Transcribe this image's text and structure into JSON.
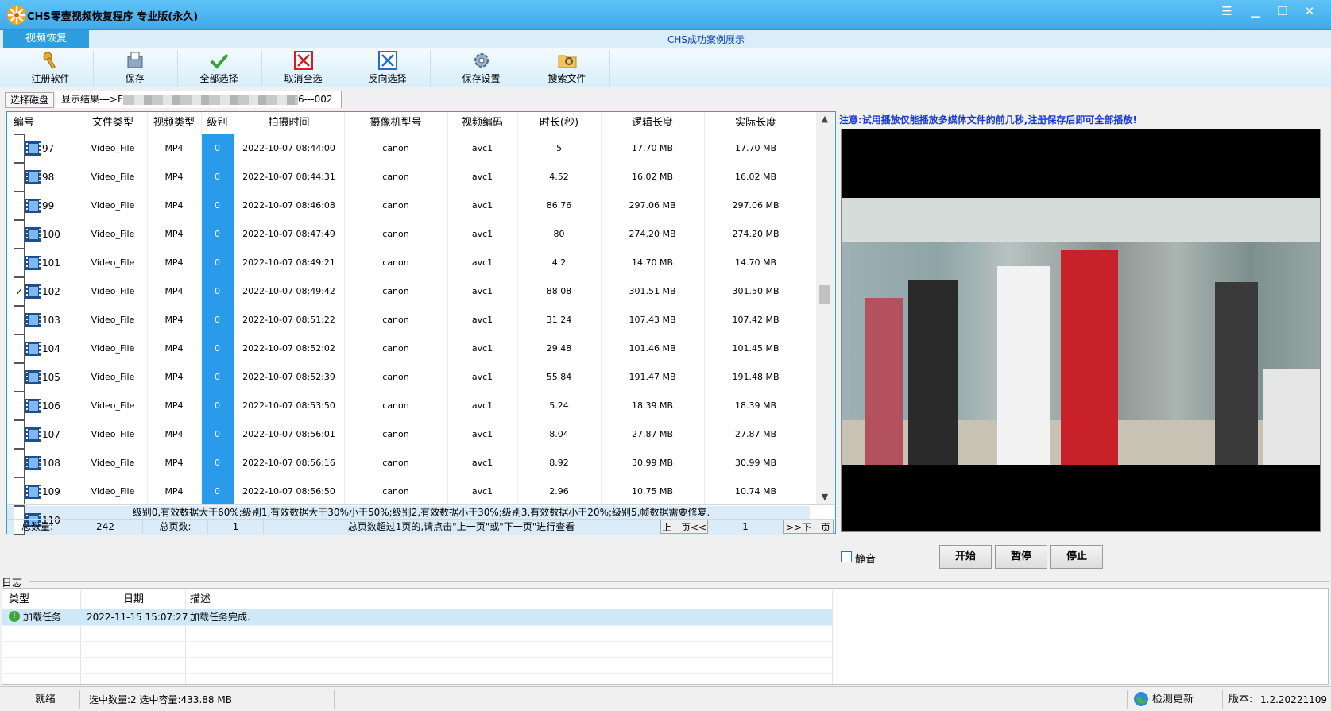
{
  "window": {
    "title": "CHS零壹视频恢复程序 专业版(永久)",
    "controls": [
      "menu-icon",
      "minimize-icon",
      "maximize-icon",
      "close-icon"
    ]
  },
  "tabs": {
    "active": "视频恢复",
    "case_link": "CHS成功案例展示"
  },
  "toolbar": {
    "register": "注册软件",
    "save": "保存",
    "select_all": "全部选择",
    "deselect_all": "取消全选",
    "invert": "反向选择",
    "save_settings": "保存设置",
    "search_file": "搜索文件"
  },
  "selector": {
    "disk_button": "选择磁盘",
    "result_prefix": "显示结果--->F",
    "result_suffix": "6---002"
  },
  "table": {
    "headers": [
      "编号",
      "文件类型",
      "视频类型",
      "级别",
      "拍摄时间",
      "摄像机型号",
      "视频编码",
      "时长(秒)",
      "逻辑长度",
      "实际长度"
    ],
    "rows": [
      {
        "id": "97",
        "checked": false,
        "ftype": "Video_File",
        "vtype": "MP4",
        "level": "0",
        "time": "2022-10-07 08:44:00",
        "camera": "canon",
        "codec": "avc1",
        "duration": "5",
        "logical": "17.70 MB",
        "actual": "17.70 MB"
      },
      {
        "id": "98",
        "checked": false,
        "ftype": "Video_File",
        "vtype": "MP4",
        "level": "0",
        "time": "2022-10-07 08:44:31",
        "camera": "canon",
        "codec": "avc1",
        "duration": "4.52",
        "logical": "16.02 MB",
        "actual": "16.02 MB"
      },
      {
        "id": "99",
        "checked": false,
        "ftype": "Video_File",
        "vtype": "MP4",
        "level": "0",
        "time": "2022-10-07 08:46:08",
        "camera": "canon",
        "codec": "avc1",
        "duration": "86.76",
        "logical": "297.06 MB",
        "actual": "297.06 MB"
      },
      {
        "id": "100",
        "checked": false,
        "ftype": "Video_File",
        "vtype": "MP4",
        "level": "0",
        "time": "2022-10-07 08:47:49",
        "camera": "canon",
        "codec": "avc1",
        "duration": "80",
        "logical": "274.20 MB",
        "actual": "274.20 MB"
      },
      {
        "id": "101",
        "checked": false,
        "ftype": "Video_File",
        "vtype": "MP4",
        "level": "0",
        "time": "2022-10-07 08:49:21",
        "camera": "canon",
        "codec": "avc1",
        "duration": "4.2",
        "logical": "14.70 MB",
        "actual": "14.70 MB"
      },
      {
        "id": "102",
        "checked": true,
        "ftype": "Video_File",
        "vtype": "MP4",
        "level": "0",
        "time": "2022-10-07 08:49:42",
        "camera": "canon",
        "codec": "avc1",
        "duration": "88.08",
        "logical": "301.51 MB",
        "actual": "301.50 MB"
      },
      {
        "id": "103",
        "checked": false,
        "ftype": "Video_File",
        "vtype": "MP4",
        "level": "0",
        "time": "2022-10-07 08:51:22",
        "camera": "canon",
        "codec": "avc1",
        "duration": "31.24",
        "logical": "107.43 MB",
        "actual": "107.42 MB"
      },
      {
        "id": "104",
        "checked": false,
        "ftype": "Video_File",
        "vtype": "MP4",
        "level": "0",
        "time": "2022-10-07 08:52:02",
        "camera": "canon",
        "codec": "avc1",
        "duration": "29.48",
        "logical": "101.46 MB",
        "actual": "101.45 MB"
      },
      {
        "id": "105",
        "checked": false,
        "ftype": "Video_File",
        "vtype": "MP4",
        "level": "0",
        "time": "2022-10-07 08:52:39",
        "camera": "canon",
        "codec": "avc1",
        "duration": "55.84",
        "logical": "191.47 MB",
        "actual": "191.48 MB"
      },
      {
        "id": "106",
        "checked": false,
        "ftype": "Video_File",
        "vtype": "MP4",
        "level": "0",
        "time": "2022-10-07 08:53:50",
        "camera": "canon",
        "codec": "avc1",
        "duration": "5.24",
        "logical": "18.39 MB",
        "actual": "18.39 MB"
      },
      {
        "id": "107",
        "checked": false,
        "ftype": "Video_File",
        "vtype": "MP4",
        "level": "0",
        "time": "2022-10-07 08:56:01",
        "camera": "canon",
        "codec": "avc1",
        "duration": "8.04",
        "logical": "27.87 MB",
        "actual": "27.87 MB"
      },
      {
        "id": "108",
        "checked": false,
        "ftype": "Video_File",
        "vtype": "MP4",
        "level": "0",
        "time": "2022-10-07 08:56:16",
        "camera": "canon",
        "codec": "avc1",
        "duration": "8.92",
        "logical": "30.99 MB",
        "actual": "30.99 MB"
      },
      {
        "id": "109",
        "checked": false,
        "ftype": "Video_File",
        "vtype": "MP4",
        "level": "0",
        "time": "2022-10-07 08:56:50",
        "camera": "canon",
        "codec": "avc1",
        "duration": "2.96",
        "logical": "10.75 MB",
        "actual": "10.74 MB"
      },
      {
        "id": "110",
        "checked": false,
        "ftype": "",
        "vtype": "",
        "level": "",
        "time": "",
        "camera": "",
        "codec": "",
        "duration": "",
        "logical": "",
        "actual": ""
      }
    ],
    "legend": "级别0,有效数据大于60%;级别1,有效数据大于30%小于50%;级别2,有效数据小于30%;级别3,有效数据小于20%;级别5,帧数据需要修复.",
    "pager": {
      "total_label": "总数量:",
      "total_value": "242",
      "pages_label": "总页数:",
      "pages_value": "1",
      "hint": "总页数超过1页的,请点击\"上一页\"或\"下一页\"进行查看",
      "prev": "上一页<<",
      "current": "1",
      "next": ">>下一页"
    }
  },
  "preview": {
    "notice": "注意:试用播放仅能播放多媒体文件的前几秒,注册保存后即可全部播放!",
    "mute": "静音",
    "start": "开始",
    "pause": "暂停",
    "stop": "停止"
  },
  "log": {
    "title": "日志",
    "headers": [
      "类型",
      "日期",
      "描述"
    ],
    "rows": [
      {
        "type": "加载任务",
        "date": "2022-11-15 15:07:27",
        "desc": "加载任务完成."
      }
    ]
  },
  "status": {
    "ready": "就绪",
    "selection": "选中数量:2 选中容量:433.88 MB",
    "update": "检测更新",
    "version_label": "版本:",
    "version": "1.2.20221109"
  },
  "colors": {
    "accent": "#2d9fe0",
    "level_band": "#2a9bea",
    "notice": "#1a3ad6"
  }
}
